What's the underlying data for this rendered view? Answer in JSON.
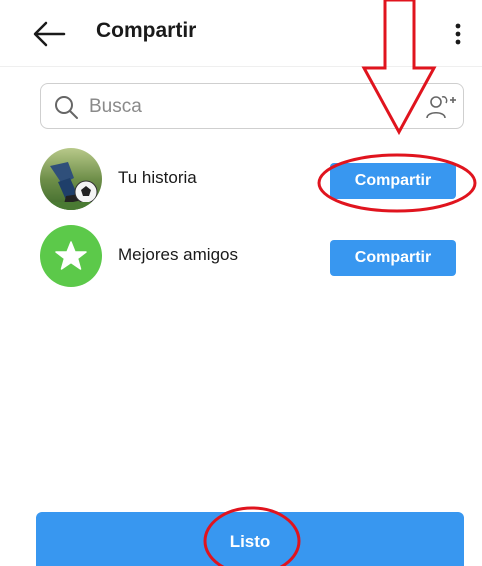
{
  "header": {
    "title": "Compartir",
    "back_icon": "arrow-left-icon",
    "more_icon": "more-vertical-icon"
  },
  "search": {
    "placeholder": "Busca",
    "value": "",
    "search_icon": "search-icon",
    "add_people_icon": "add-people-icon"
  },
  "rows": [
    {
      "label": "Tu historia",
      "avatar": "story-avatar-soccer",
      "button_label": "Compartir"
    },
    {
      "label": "Mejores amigos",
      "avatar": "close-friends-star",
      "button_label": "Compartir"
    }
  ],
  "footer": {
    "done_label": "Listo"
  },
  "colors": {
    "accent": "#3897f0",
    "close_friends": "#5cc94a",
    "annotation": "#e0141e"
  }
}
